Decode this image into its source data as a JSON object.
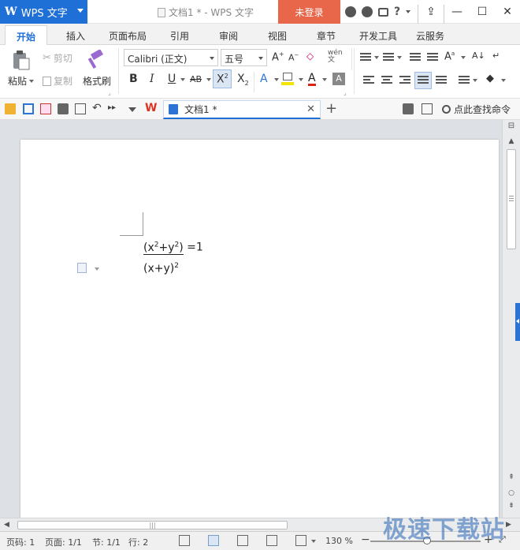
{
  "app": {
    "name": "WPS 文字",
    "window_title": "文档1 * - WPS 文字",
    "login_label": "未登录"
  },
  "ribbon_tabs": [
    {
      "label": "开始",
      "active": true
    },
    {
      "label": "插入"
    },
    {
      "label": "页面布局"
    },
    {
      "label": "引用"
    },
    {
      "label": "审阅"
    },
    {
      "label": "视图"
    },
    {
      "label": "章节"
    },
    {
      "label": "开发工具"
    },
    {
      "label": "云服务"
    }
  ],
  "clipboard": {
    "paste": "粘贴",
    "cut": "剪切",
    "copy": "复制",
    "format_painter": "格式刷"
  },
  "font": {
    "family": "Calibri (正文)",
    "size": "五号"
  },
  "doc_tab": {
    "label": "文档1 *"
  },
  "find_command": "点此查找命令",
  "document": {
    "line1_base": "(x",
    "line1_sup1": "2",
    "line1_mid": "+y",
    "line1_sup2": "2",
    "line1_close": ")",
    "line1_tail": " =1",
    "line2_base": "(x+y)",
    "line2_sup": "2"
  },
  "statusbar": {
    "page_num": "页码: 1",
    "pages": "页面: 1/1",
    "section": "节: 1/1",
    "line": "行: 2",
    "zoom": "130 %"
  },
  "watermark": "极速下载站",
  "colors": {
    "accent": "#1e6fd6",
    "login": "#e8664a"
  }
}
